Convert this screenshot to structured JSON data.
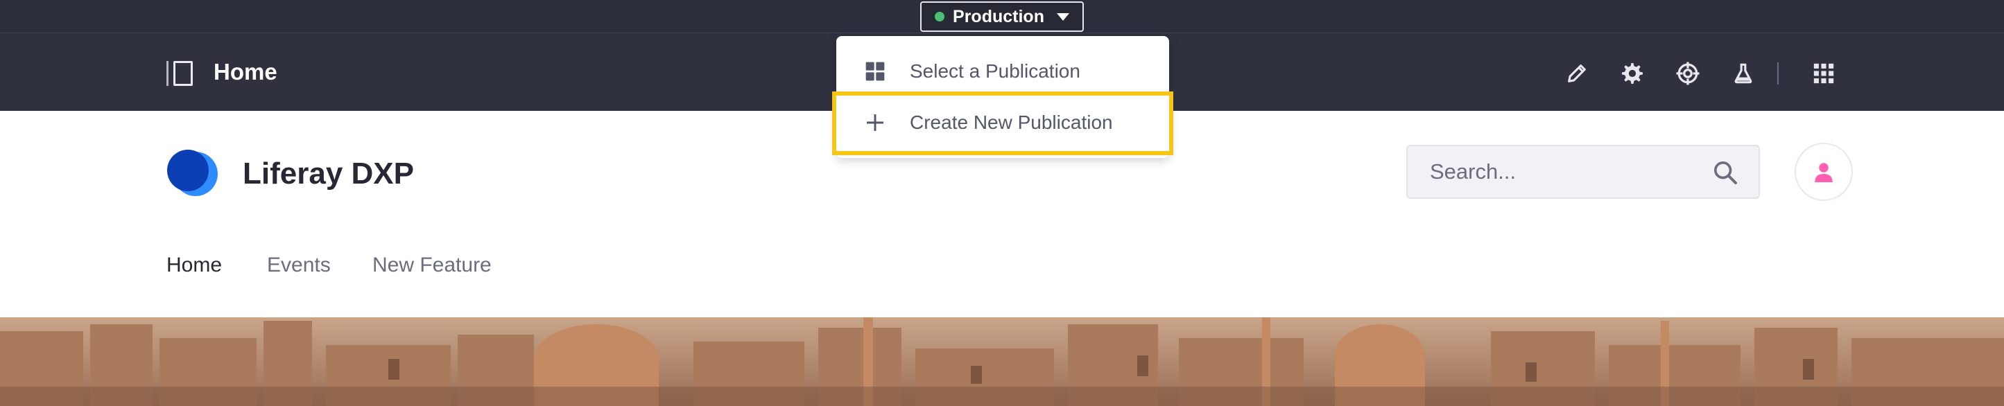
{
  "environment": {
    "label": "Production",
    "status_color": "#4bbe73"
  },
  "control_menu": {
    "title": "Home",
    "icons": [
      "pencil-icon",
      "gear-icon",
      "target-icon",
      "flask-icon",
      "apps-grid-icon"
    ]
  },
  "publication_menu": {
    "items": [
      {
        "label": "Select a Publication",
        "icon": "grid-icon"
      },
      {
        "label": "Create New Publication",
        "icon": "plus-icon"
      }
    ],
    "highlight_color": "#f5c518"
  },
  "site": {
    "name": "Liferay DXP",
    "brand_color": "#0b5fff"
  },
  "search": {
    "placeholder": "Search...",
    "value": ""
  },
  "nav": {
    "items": [
      {
        "label": "Home",
        "active": true
      },
      {
        "label": "Events",
        "active": false
      },
      {
        "label": "New Feature",
        "active": false
      }
    ]
  },
  "user": {
    "avatar_color": "#ff5fb2"
  }
}
